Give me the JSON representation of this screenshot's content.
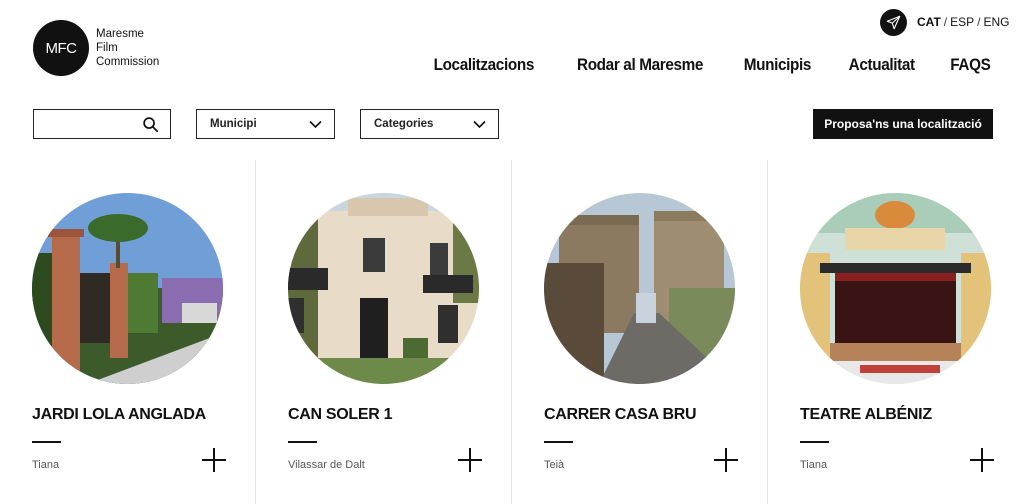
{
  "logo": {
    "mark": "MFC",
    "lines": [
      "Maresme",
      "Film",
      "Commission"
    ]
  },
  "header": {
    "send_icon": "paper-plane-icon",
    "languages": [
      {
        "label": "CAT",
        "active": true
      },
      {
        "label": "ESP",
        "active": false
      },
      {
        "label": "ENG",
        "active": false
      }
    ],
    "nav": [
      "Localitzacions",
      "Rodar al Maresme",
      "Municipis",
      "Actualitat",
      "FAQS"
    ]
  },
  "filters": {
    "search": {
      "value": "",
      "placeholder": "",
      "icon": "search-icon"
    },
    "municipi": {
      "selected": "Municipi",
      "icon": "chevron-down-icon"
    },
    "categories": {
      "selected": "Categories",
      "icon": "chevron-down-icon"
    },
    "propose_label": "Proposa'ns una localització"
  },
  "locations": [
    {
      "title": "JARDI LOLA ANGLADA",
      "town": "Tiana"
    },
    {
      "title": "CAN SOLER 1",
      "town": "Vilassar de Dalt"
    },
    {
      "title": "CARRER CASA BRU",
      "town": "Teià"
    },
    {
      "title": "TEATRE ALBÉNIZ",
      "town": "Tiana"
    }
  ],
  "colors": {
    "text": "#111111",
    "muted": "#555555",
    "divider": "#e4e4e4",
    "button_bg": "#111111"
  }
}
